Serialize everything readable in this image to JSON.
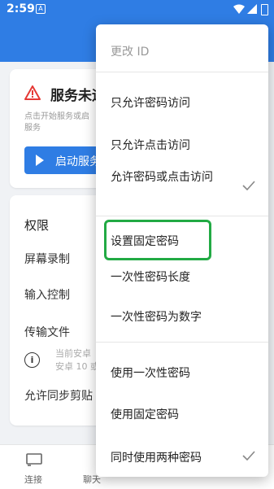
{
  "status_bar": {
    "time": "2:59",
    "notification_icon": "A"
  },
  "service_card": {
    "icon": "warning-icon",
    "title": "服务未运",
    "description": "点击开始服务或启\n服务",
    "start_button": "启动服务"
  },
  "permissions": {
    "title": "权限",
    "items": [
      "屏幕录制",
      "输入控制",
      "传输文件"
    ],
    "note_lines": [
      "当前安卓",
      "安卓 10 或"
    ],
    "clipboard": "允许同步剪贴"
  },
  "bottom_nav": [
    {
      "label": "连接",
      "icon": "cast-icon"
    },
    {
      "label": "聊天"
    }
  ],
  "menu": {
    "change_id": "更改 ID",
    "items": [
      {
        "label": "只允许密码访问",
        "checked": false
      },
      {
        "label": "只允许点击访问",
        "checked": false
      },
      {
        "label": "允许密码或点击访问",
        "checked": true
      }
    ],
    "password_items": [
      {
        "label": "设置固定密码"
      },
      {
        "label": "一次性密码长度"
      },
      {
        "label": "一次性密码为数字"
      }
    ],
    "usage_items": [
      {
        "label": "使用一次性密码",
        "checked": false
      },
      {
        "label": "使用固定密码",
        "checked": false
      },
      {
        "label": "同时使用两种密码",
        "checked": true
      }
    ]
  },
  "colors": {
    "accent": "#2f7de4",
    "highlight": "#22aa44",
    "warning": "#e53935"
  }
}
